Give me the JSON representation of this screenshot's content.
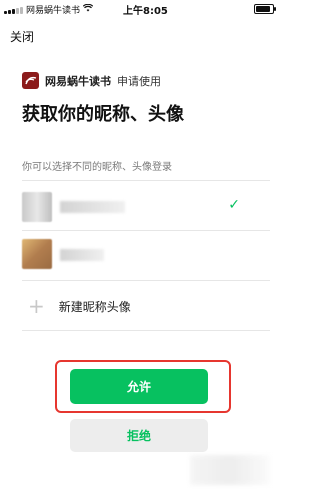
{
  "statusbar": {
    "carrier": "网易蜗牛读书",
    "time": "上午8:05",
    "battery_level": 0.9
  },
  "header": {
    "close_label": "关闭"
  },
  "app": {
    "name": "网易蜗牛读书",
    "request": "申请使用"
  },
  "page": {
    "title": "获取你的昵称、头像",
    "hint": "你可以选择不同的昵称、头像登录"
  },
  "accounts": [
    {
      "selected": true
    },
    {
      "selected": false
    }
  ],
  "new_profile": {
    "label": "新建昵称头像"
  },
  "buttons": {
    "allow": "允许",
    "deny": "拒绝"
  },
  "colors": {
    "accent": "#07c160",
    "highlight": "#e6362f",
    "app_logo": "#8b1b1b"
  },
  "icons": {
    "check": "check-icon",
    "plus": "plus-icon",
    "app": "app-logo-icon"
  }
}
